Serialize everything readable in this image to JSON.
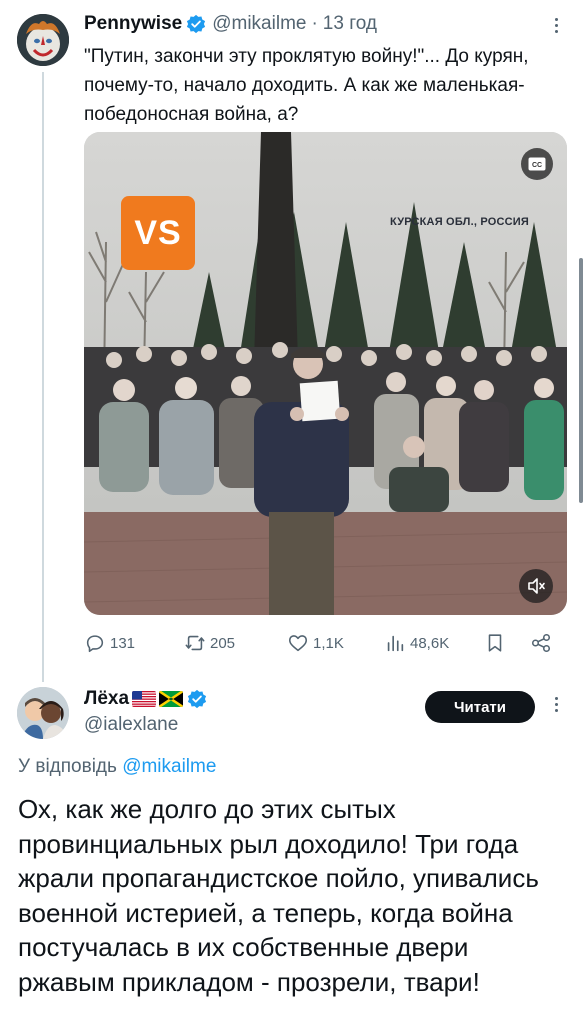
{
  "tweet1": {
    "author_name": "Pennywise",
    "author_handle": "@mikailme",
    "separator": "·",
    "time": "13 год",
    "text": "\"Путин, закончи эту проклятую войну!\"... До курян, почему-то, начало доходить. А как же маленькая-победоносная война, а?",
    "media": {
      "badge": "VS",
      "location": "КУРСКАЯ ОБЛ., РОССИЯ",
      "cc_label": "CC",
      "mute_icon": "speaker-muted-icon"
    },
    "actions": {
      "replies": "131",
      "reposts": "205",
      "likes": "1,1K",
      "views": "48,6K"
    }
  },
  "tweet2": {
    "author_name": "Лёха",
    "author_handle": "@ialexlane",
    "follow_label": "Читати",
    "reply_prefix": "У відповідь",
    "reply_mention": "@mikailme",
    "text": "Ох, как же долго до этих сытых провинциальных рыл доходило! Три года жрали пропагандистское пойло, упивались военной истерией, а теперь, когда война постучалась в их собственные двери ржавым прикладом - прозрели, твари!"
  },
  "colors": {
    "text_primary": "#0f1419",
    "text_secondary": "#536471",
    "accent": "#1d9bf0",
    "vs_orange": "#f07a1e"
  }
}
